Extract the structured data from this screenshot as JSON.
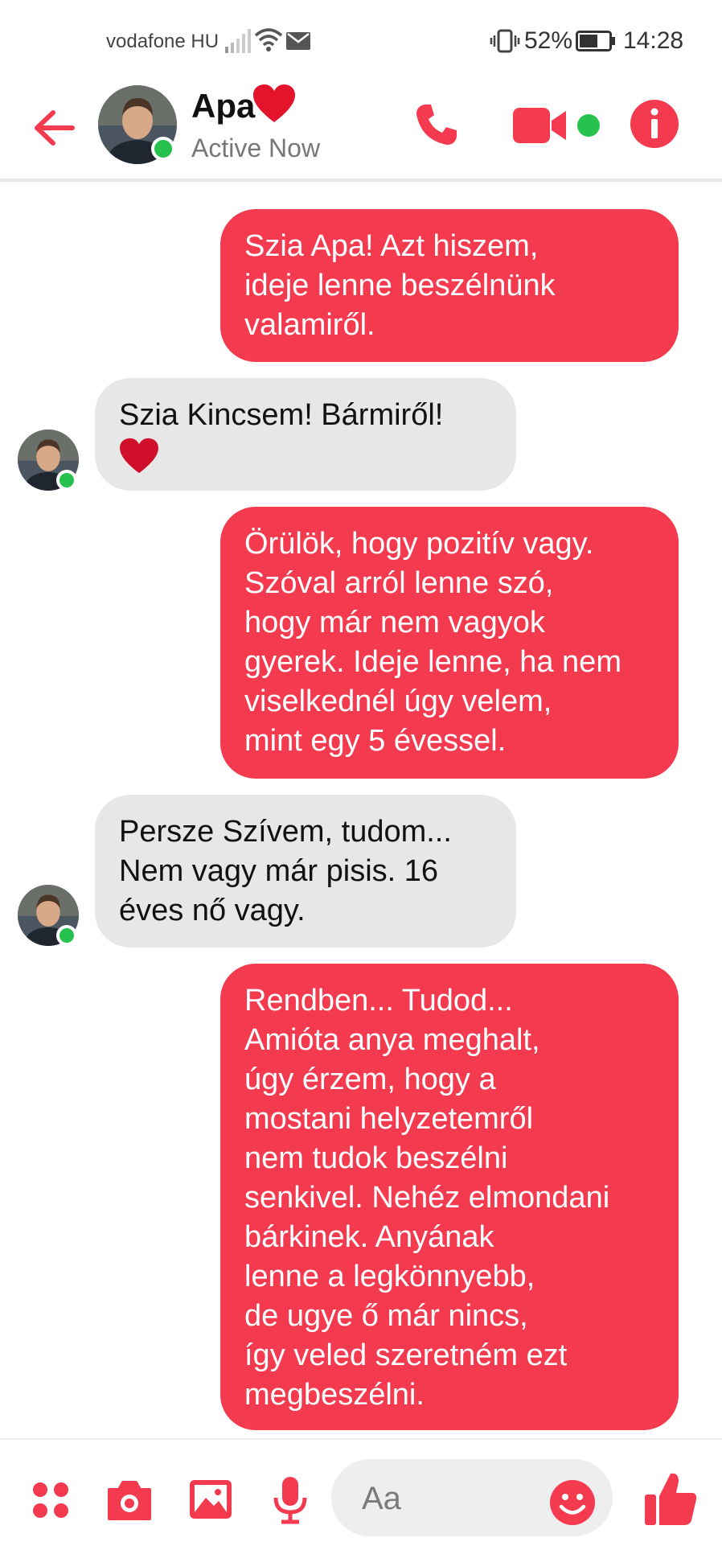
{
  "status_bar": {
    "carrier": "vodafone HU",
    "battery": "52%",
    "time": "14:28",
    "icons": [
      "signal-icon",
      "wifi-icon",
      "message-notification-icon",
      "vibrate-icon",
      "battery-icon"
    ]
  },
  "header": {
    "contact_name": "Apa",
    "presence": "Active Now",
    "icons": [
      "back-arrow-icon",
      "heart-icon",
      "phone-icon",
      "video-camera-icon",
      "info-icon"
    ]
  },
  "messages": [
    {
      "direction": "outgoing",
      "lines": [
        "Szia Apa! Azt hiszem,",
        "ideje lenne beszélnünk",
        "valamiről."
      ]
    },
    {
      "direction": "incoming",
      "lines": [
        "Szia Kincsem! Bármiről!"
      ],
      "emoji": "heart"
    },
    {
      "direction": "outgoing",
      "lines": [
        "Örülök, hogy pozitív vagy.",
        "Szóval arról lenne szó,",
        "hogy már nem vagyok",
        "gyerek. Ideje lenne, ha nem",
        "viselkednél úgy velem,",
        "mint egy 5 évessel."
      ]
    },
    {
      "direction": "incoming",
      "lines": [
        "Persze Szívem, tudom...",
        "Nem vagy már pisis. 16",
        "éves nő vagy."
      ]
    },
    {
      "direction": "outgoing",
      "lines": [
        "Rendben... Tudod...",
        "Amióta anya meghalt,",
        "úgy érzem, hogy a",
        "mostani helyzetemről",
        "nem tudok beszélni",
        "senkivel. Nehéz elmondani",
        "bárkinek. Anyának",
        "lenne a legkönnyebb,",
        "de ugye ő már nincs,",
        "így veled szeretném ezt",
        "megbeszélni."
      ]
    }
  ],
  "composer": {
    "placeholder": "Aa",
    "icons": [
      "menu-dots-icon",
      "camera-icon",
      "gallery-icon",
      "microphone-icon",
      "emoji-icon",
      "thumbs-up-icon"
    ]
  },
  "colors": {
    "accent": "#f43a4f",
    "incoming_bubble": "#e7e7e7",
    "online": "#26c24d"
  }
}
